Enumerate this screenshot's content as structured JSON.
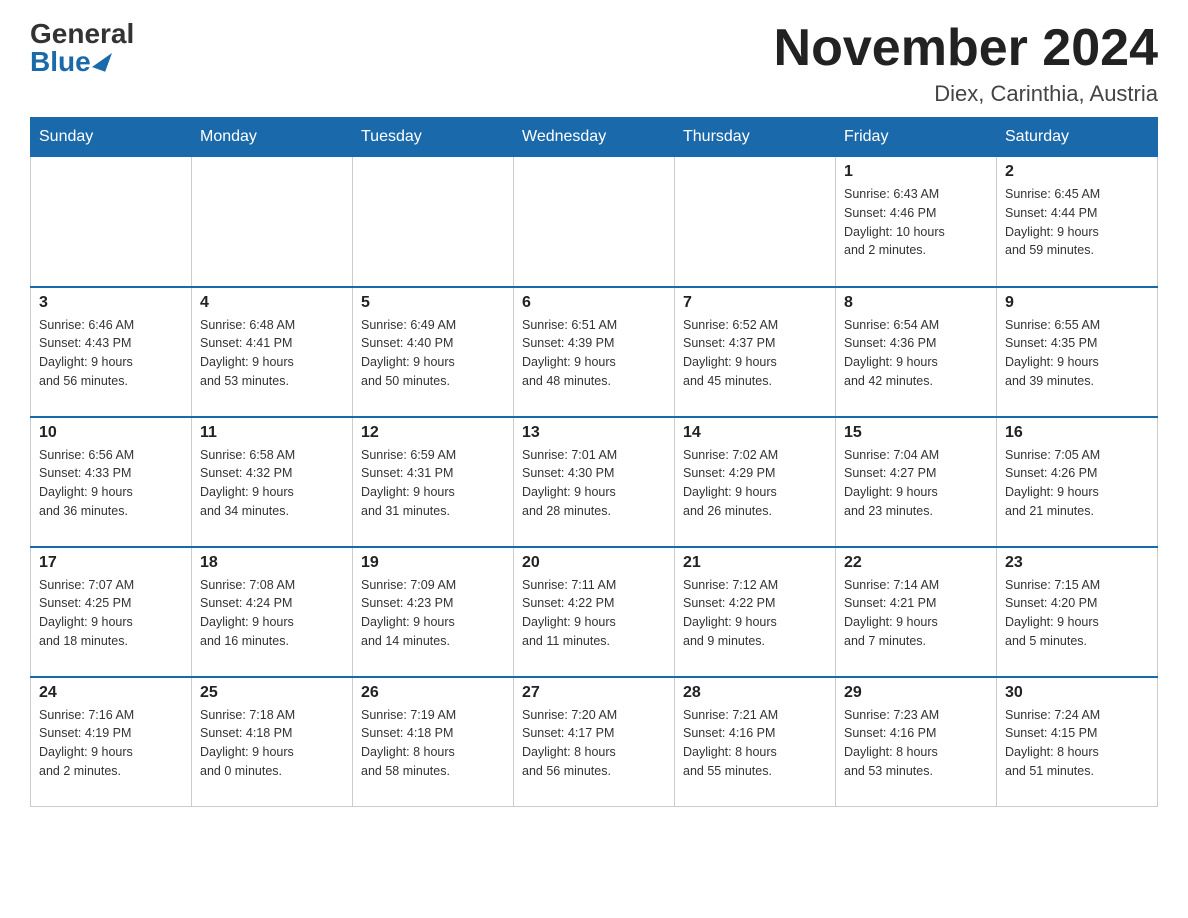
{
  "header": {
    "logo_general": "General",
    "logo_blue": "Blue",
    "month_title": "November 2024",
    "location": "Diex, Carinthia, Austria"
  },
  "weekdays": [
    "Sunday",
    "Monday",
    "Tuesday",
    "Wednesday",
    "Thursday",
    "Friday",
    "Saturday"
  ],
  "weeks": [
    [
      {
        "day": "",
        "info": ""
      },
      {
        "day": "",
        "info": ""
      },
      {
        "day": "",
        "info": ""
      },
      {
        "day": "",
        "info": ""
      },
      {
        "day": "",
        "info": ""
      },
      {
        "day": "1",
        "info": "Sunrise: 6:43 AM\nSunset: 4:46 PM\nDaylight: 10 hours\nand 2 minutes."
      },
      {
        "day": "2",
        "info": "Sunrise: 6:45 AM\nSunset: 4:44 PM\nDaylight: 9 hours\nand 59 minutes."
      }
    ],
    [
      {
        "day": "3",
        "info": "Sunrise: 6:46 AM\nSunset: 4:43 PM\nDaylight: 9 hours\nand 56 minutes."
      },
      {
        "day": "4",
        "info": "Sunrise: 6:48 AM\nSunset: 4:41 PM\nDaylight: 9 hours\nand 53 minutes."
      },
      {
        "day": "5",
        "info": "Sunrise: 6:49 AM\nSunset: 4:40 PM\nDaylight: 9 hours\nand 50 minutes."
      },
      {
        "day": "6",
        "info": "Sunrise: 6:51 AM\nSunset: 4:39 PM\nDaylight: 9 hours\nand 48 minutes."
      },
      {
        "day": "7",
        "info": "Sunrise: 6:52 AM\nSunset: 4:37 PM\nDaylight: 9 hours\nand 45 minutes."
      },
      {
        "day": "8",
        "info": "Sunrise: 6:54 AM\nSunset: 4:36 PM\nDaylight: 9 hours\nand 42 minutes."
      },
      {
        "day": "9",
        "info": "Sunrise: 6:55 AM\nSunset: 4:35 PM\nDaylight: 9 hours\nand 39 minutes."
      }
    ],
    [
      {
        "day": "10",
        "info": "Sunrise: 6:56 AM\nSunset: 4:33 PM\nDaylight: 9 hours\nand 36 minutes."
      },
      {
        "day": "11",
        "info": "Sunrise: 6:58 AM\nSunset: 4:32 PM\nDaylight: 9 hours\nand 34 minutes."
      },
      {
        "day": "12",
        "info": "Sunrise: 6:59 AM\nSunset: 4:31 PM\nDaylight: 9 hours\nand 31 minutes."
      },
      {
        "day": "13",
        "info": "Sunrise: 7:01 AM\nSunset: 4:30 PM\nDaylight: 9 hours\nand 28 minutes."
      },
      {
        "day": "14",
        "info": "Sunrise: 7:02 AM\nSunset: 4:29 PM\nDaylight: 9 hours\nand 26 minutes."
      },
      {
        "day": "15",
        "info": "Sunrise: 7:04 AM\nSunset: 4:27 PM\nDaylight: 9 hours\nand 23 minutes."
      },
      {
        "day": "16",
        "info": "Sunrise: 7:05 AM\nSunset: 4:26 PM\nDaylight: 9 hours\nand 21 minutes."
      }
    ],
    [
      {
        "day": "17",
        "info": "Sunrise: 7:07 AM\nSunset: 4:25 PM\nDaylight: 9 hours\nand 18 minutes."
      },
      {
        "day": "18",
        "info": "Sunrise: 7:08 AM\nSunset: 4:24 PM\nDaylight: 9 hours\nand 16 minutes."
      },
      {
        "day": "19",
        "info": "Sunrise: 7:09 AM\nSunset: 4:23 PM\nDaylight: 9 hours\nand 14 minutes."
      },
      {
        "day": "20",
        "info": "Sunrise: 7:11 AM\nSunset: 4:22 PM\nDaylight: 9 hours\nand 11 minutes."
      },
      {
        "day": "21",
        "info": "Sunrise: 7:12 AM\nSunset: 4:22 PM\nDaylight: 9 hours\nand 9 minutes."
      },
      {
        "day": "22",
        "info": "Sunrise: 7:14 AM\nSunset: 4:21 PM\nDaylight: 9 hours\nand 7 minutes."
      },
      {
        "day": "23",
        "info": "Sunrise: 7:15 AM\nSunset: 4:20 PM\nDaylight: 9 hours\nand 5 minutes."
      }
    ],
    [
      {
        "day": "24",
        "info": "Sunrise: 7:16 AM\nSunset: 4:19 PM\nDaylight: 9 hours\nand 2 minutes."
      },
      {
        "day": "25",
        "info": "Sunrise: 7:18 AM\nSunset: 4:18 PM\nDaylight: 9 hours\nand 0 minutes."
      },
      {
        "day": "26",
        "info": "Sunrise: 7:19 AM\nSunset: 4:18 PM\nDaylight: 8 hours\nand 58 minutes."
      },
      {
        "day": "27",
        "info": "Sunrise: 7:20 AM\nSunset: 4:17 PM\nDaylight: 8 hours\nand 56 minutes."
      },
      {
        "day": "28",
        "info": "Sunrise: 7:21 AM\nSunset: 4:16 PM\nDaylight: 8 hours\nand 55 minutes."
      },
      {
        "day": "29",
        "info": "Sunrise: 7:23 AM\nSunset: 4:16 PM\nDaylight: 8 hours\nand 53 minutes."
      },
      {
        "day": "30",
        "info": "Sunrise: 7:24 AM\nSunset: 4:15 PM\nDaylight: 8 hours\nand 51 minutes."
      }
    ]
  ]
}
